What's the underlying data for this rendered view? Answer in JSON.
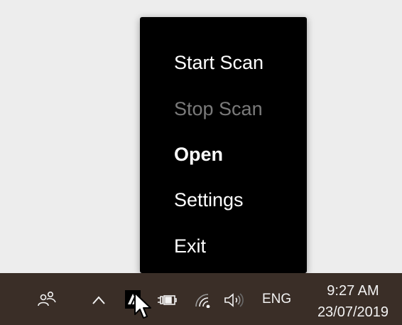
{
  "context_menu": {
    "items": [
      {
        "label": "Start Scan",
        "state": "enabled"
      },
      {
        "label": "Stop Scan",
        "state": "disabled"
      },
      {
        "label": "Open",
        "state": "default"
      },
      {
        "label": "Settings",
        "state": "enabled"
      },
      {
        "label": "Exit",
        "state": "enabled"
      }
    ]
  },
  "taskbar": {
    "icons": [
      "people-icon",
      "chevron-up-icon",
      "app-tray-icon",
      "power-battery-icon",
      "wifi-icon",
      "speaker-icon"
    ],
    "language": "ENG",
    "time": "9:27 AM",
    "date": "23/07/2019"
  },
  "colors": {
    "menu_background": "#000000",
    "menu_text": "#ffffff",
    "menu_text_disabled": "#7a7a7a",
    "taskbar_background": "#3a2e27",
    "desktop_background": "#ededed"
  }
}
